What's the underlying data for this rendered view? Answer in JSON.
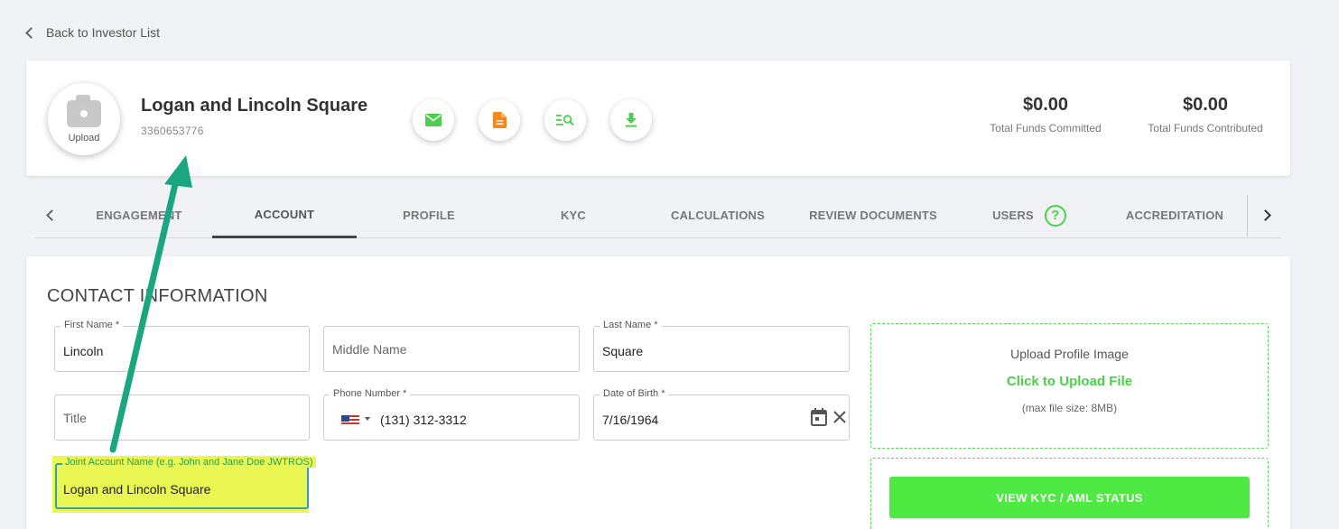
{
  "nav": {
    "back_label": "Back to Investor List"
  },
  "investor": {
    "name": "Logan and Lincoln Square",
    "id": "3360653776",
    "avatar_label": "Upload"
  },
  "actions": [
    {
      "name": "email",
      "icon": "mail-icon"
    },
    {
      "name": "document",
      "icon": "document-icon"
    },
    {
      "name": "review",
      "icon": "list-search-icon"
    },
    {
      "name": "download",
      "icon": "download-icon"
    }
  ],
  "stats": [
    {
      "amount": "$0.00",
      "label": "Total Funds Committed"
    },
    {
      "amount": "$0.00",
      "label": "Total Funds Contributed"
    }
  ],
  "tabs": [
    "ENGAGEMENT",
    "ACCOUNT",
    "PROFILE",
    "KYC",
    "CALCULATIONS",
    "REVIEW DOCUMENTS",
    "USERS",
    "ACCREDITATION"
  ],
  "active_tab": "ACCOUNT",
  "help_glyph": "?",
  "form": {
    "section_title": "CONTACT INFORMATION",
    "first_name": {
      "label": "First Name *",
      "value": "Lincoln"
    },
    "middle_name": {
      "placeholder": "Middle Name"
    },
    "last_name": {
      "label": "Last Name *",
      "value": "Square"
    },
    "title": {
      "placeholder": "Title"
    },
    "phone": {
      "label": "Phone Number *",
      "value": "(131) 312-3312"
    },
    "dob": {
      "label": "Date of Birth *",
      "value": "7/16/1964"
    },
    "joint_account": {
      "label": "Joint Account Name (e.g. John and Jane Doe JWTROS)",
      "value": "Logan and Lincoln Square"
    }
  },
  "upload": {
    "title": "Upload Profile Image",
    "link": "Click to Upload File",
    "hint": "(max file size: 8MB)"
  },
  "kyc_button": "VIEW KYC / AML STATUS",
  "colors": {
    "accent_green": "#4cd04c",
    "kyc_button": "#4fe943",
    "annotation_arrow": "#1aa67f",
    "highlight": "#eaf752",
    "email_icon": "#4cd04c",
    "document_icon": "#f5871f"
  }
}
